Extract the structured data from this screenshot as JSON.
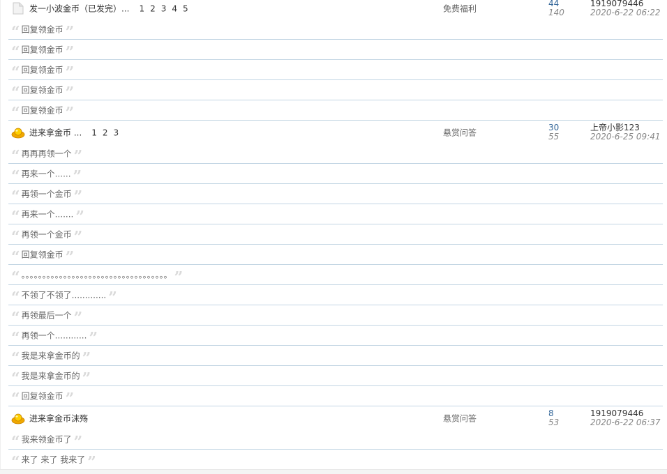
{
  "quote_open": "“",
  "quote_close": "”",
  "threads": [
    {
      "icon": "document-icon",
      "title": "发一小波金币（已发完）...",
      "pages": [
        "1",
        "2",
        "3",
        "4",
        "5"
      ],
      "forum": "免费福利",
      "replies": "44",
      "views": "140",
      "author": "1919079446",
      "date": "2020-6-22 06:22",
      "posts": [
        "回复领金币",
        "回复领金币",
        "回复领金币",
        "回复领金币",
        "回复领金币"
      ]
    },
    {
      "icon": "gold-ingot-icon",
      "title": "进来拿金币 ...",
      "pages": [
        "1",
        "2",
        "3"
      ],
      "forum": "悬赏问答",
      "replies": "30",
      "views": "55",
      "author": "上帝小影123",
      "date": "2020-6-25 09:41",
      "posts": [
        "再再再领一个",
        "再来一个......",
        "再领一个金币",
        "再来一个.......",
        "再领一个金币",
        "回复领金币",
        "。。。。。。。。。。。。。。。。。。。。。。。。。。。。。。。。。。。",
        "不领了不领了.............",
        "再领最后一个",
        "再领一个............",
        "我是来拿金币的",
        "我是来拿金币的",
        "回复领金币"
      ]
    },
    {
      "icon": "gold-ingot-icon",
      "title": "进来拿金币沫殇",
      "pages": [],
      "forum": "悬赏问答",
      "replies": "8",
      "views": "53",
      "author": "1919079446",
      "date": "2020-6-22 06:37",
      "posts": [
        "我来领金币了",
        "来了 来了 我来了"
      ]
    }
  ]
}
